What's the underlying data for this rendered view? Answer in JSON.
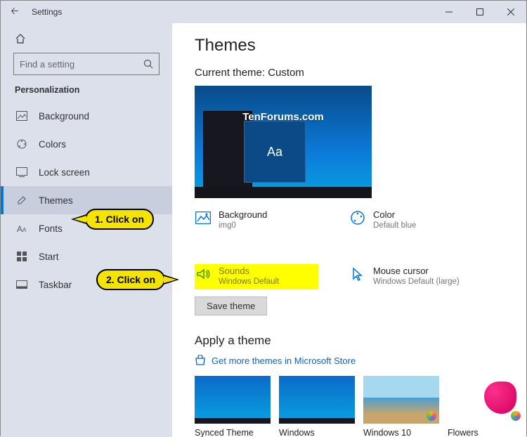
{
  "window": {
    "title": "Settings"
  },
  "callouts": {
    "c1": "1. Click on",
    "c2": "2. Click on"
  },
  "sidebar": {
    "search_placeholder": "Find a setting",
    "section": "Personalization",
    "items": [
      {
        "label": "Background"
      },
      {
        "label": "Colors"
      },
      {
        "label": "Lock screen"
      },
      {
        "label": "Themes"
      },
      {
        "label": "Fonts"
      },
      {
        "label": "Start"
      },
      {
        "label": "Taskbar"
      }
    ]
  },
  "main": {
    "heading": "Themes",
    "current_label": "Current theme: Custom",
    "watermark": "TenForums.com",
    "preview_aa": "Aa",
    "props": {
      "bg_label": "Background",
      "bg_value": "img0",
      "color_label": "Color",
      "color_value": "Default blue",
      "sound_label": "Sounds",
      "sound_value": "Windows Default",
      "cursor_label": "Mouse cursor",
      "cursor_value": "Windows Default (large)"
    },
    "save_btn": "Save theme",
    "apply_heading": "Apply a theme",
    "store_link": "Get more themes in Microsoft Store",
    "thumbs": [
      {
        "label": "Synced Theme"
      },
      {
        "label": "Windows"
      },
      {
        "label": "Windows 10"
      },
      {
        "label": "Flowers"
      }
    ]
  }
}
